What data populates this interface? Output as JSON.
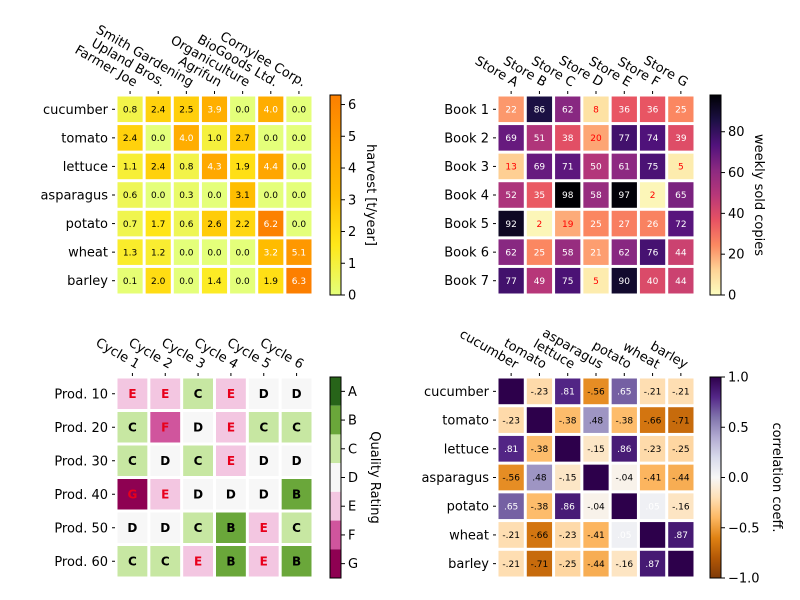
{
  "chart_data": [
    {
      "type": "heatmap",
      "id": "harvest",
      "columns": [
        "Farmer Joe",
        "Upland Bros.",
        "Smith Gardening",
        "Agrifun",
        "Organiculture",
        "BioGoods Ltd.",
        "Cornylee Corp."
      ],
      "rows": [
        "cucumber",
        "tomato",
        "lettuce",
        "asparagus",
        "potato",
        "wheat",
        "barley"
      ],
      "values": [
        [
          0.8,
          2.4,
          2.5,
          3.9,
          0.0,
          4.0,
          0.0
        ],
        [
          2.4,
          0.0,
          4.0,
          1.0,
          2.7,
          0.0,
          0.0
        ],
        [
          1.1,
          2.4,
          0.8,
          4.3,
          1.9,
          4.4,
          0.0
        ],
        [
          0.6,
          0.0,
          0.3,
          0.0,
          3.1,
          0.0,
          0.0
        ],
        [
          0.7,
          1.7,
          0.6,
          2.6,
          2.2,
          6.2,
          0.0
        ],
        [
          1.3,
          1.2,
          0.0,
          0.0,
          0.0,
          3.2,
          5.1
        ],
        [
          0.1,
          2.0,
          0.0,
          1.4,
          0.0,
          1.9,
          6.3
        ]
      ],
      "value_format": "0.0",
      "colormap": "Wistia",
      "vmin": 0,
      "vmax": 6.3,
      "colorbar": {
        "label": "harvest [t/year]",
        "ticks": [
          0,
          1,
          2,
          3,
          4,
          5,
          6
        ],
        "tick_labels": [
          "0",
          "1",
          "2",
          "3",
          "4",
          "5",
          "6"
        ]
      },
      "text_colors": {
        "dark": "#000000",
        "light": "#ffffff"
      },
      "light_threshold": 3.15
    },
    {
      "type": "heatmap",
      "id": "books",
      "columns": [
        "Store A",
        "Store B",
        "Store C",
        "Store D",
        "Store E",
        "Store F",
        "Store G"
      ],
      "rows": [
        "Book 1",
        "Book 2",
        "Book 3",
        "Book 4",
        "Book 5",
        "Book 6",
        "Book 7"
      ],
      "values": [
        [
          22,
          86,
          62,
          8,
          36,
          36,
          25
        ],
        [
          69,
          51,
          38,
          20,
          77,
          74,
          39
        ],
        [
          13,
          69,
          71,
          50,
          61,
          75,
          5
        ],
        [
          52,
          35,
          98,
          58,
          97,
          2,
          65
        ],
        [
          92,
          2,
          19,
          25,
          27,
          26,
          72
        ],
        [
          62,
          25,
          58,
          21,
          62,
          76,
          44
        ],
        [
          77,
          49,
          75,
          5,
          90,
          40,
          44
        ]
      ],
      "value_format": "0",
      "colormap": "magma_r",
      "vmin": 0,
      "vmax": 98,
      "colorbar": {
        "label": "weekly sold copies",
        "ticks": [
          0,
          20,
          40,
          60,
          80
        ],
        "tick_labels": [
          "0",
          "20",
          "40",
          "60",
          "80"
        ]
      },
      "text_colors": {
        "dark": "#ff0000",
        "light": "#ffffff"
      },
      "light_threshold": 20.5
    },
    {
      "type": "heatmap",
      "id": "quality",
      "columns": [
        "Cycle 1",
        "Cycle 2",
        "Cycle 3",
        "Cycle 4",
        "Cycle 5",
        "Cycle 6"
      ],
      "rows": [
        "Prod. 10",
        "Prod. 20",
        "Prod. 30",
        "Prod. 40",
        "Prod. 50",
        "Prod. 60"
      ],
      "values": [
        [
          "E",
          "E",
          "C",
          "E",
          "D",
          "D"
        ],
        [
          "C",
          "F",
          "D",
          "E",
          "C",
          "C"
        ],
        [
          "C",
          "D",
          "C",
          "E",
          "D",
          "D"
        ],
        [
          "G",
          "E",
          "D",
          "D",
          "D",
          "B"
        ],
        [
          "D",
          "D",
          "C",
          "B",
          "E",
          "C"
        ],
        [
          "C",
          "C",
          "E",
          "B",
          "E",
          "B"
        ]
      ],
      "colormap": "PiYG (7 levels)",
      "categories": [
        "A",
        "B",
        "C",
        "D",
        "E",
        "F",
        "G"
      ],
      "category_colors": [
        "#276419",
        "#6aa73a",
        "#c7e7a2",
        "#f7f7f7",
        "#f3c6e1",
        "#d0559d",
        "#8e0152"
      ],
      "colorbar": {
        "label": "Quality Rating",
        "tick_labels": [
          "A",
          "B",
          "C",
          "D",
          "E",
          "F",
          "G"
        ]
      },
      "text_colors": {
        "good": "#000000",
        "bad": "#e8001c"
      }
    },
    {
      "type": "heatmap",
      "id": "correlation",
      "columns": [
        "cucumber",
        "tomato",
        "lettuce",
        "asparagus",
        "potato",
        "wheat",
        "barley"
      ],
      "rows": [
        "cucumber",
        "tomato",
        "lettuce",
        "asparagus",
        "potato",
        "wheat",
        "barley"
      ],
      "values": [
        [
          1.0,
          -0.23,
          0.81,
          -0.56,
          0.65,
          -0.21,
          -0.21
        ],
        [
          -0.23,
          1.0,
          -0.38,
          0.48,
          -0.38,
          -0.66,
          -0.71
        ],
        [
          0.81,
          -0.38,
          1.0,
          -0.15,
          0.86,
          -0.23,
          -0.25
        ],
        [
          -0.56,
          0.48,
          -0.15,
          1.0,
          -0.04,
          -0.41,
          -0.44
        ],
        [
          0.65,
          -0.38,
          0.86,
          -0.04,
          1.0,
          0.05,
          -0.16
        ],
        [
          -0.21,
          -0.66,
          -0.23,
          -0.41,
          0.05,
          1.0,
          0.87
        ],
        [
          -0.21,
          -0.71,
          -0.25,
          -0.44,
          -0.16,
          0.87,
          1.0
        ]
      ],
      "cell_labels": [
        [
          "",
          "-.23",
          ".81",
          "-.56",
          ".65",
          "-.21",
          "-.21"
        ],
        [
          "-.23",
          "",
          "-.38",
          ".48",
          "-.38",
          "-.66",
          "-.71"
        ],
        [
          ".81",
          "-.38",
          "",
          "-.15",
          ".86",
          "-.23",
          "-.25"
        ],
        [
          "-.56",
          ".48",
          "-.15",
          "",
          "-.04",
          "-.41",
          "-.44"
        ],
        [
          ".65",
          "-.38",
          ".86",
          "-.04",
          "",
          ".05",
          "-.16"
        ],
        [
          "-.21",
          "-.66",
          "-.23",
          "-.41",
          ".05",
          "",
          ".87"
        ],
        [
          "-.21",
          "-.71",
          "-.25",
          "-.44",
          "-.16",
          ".87",
          ""
        ]
      ],
      "colormap": "PuOr",
      "vmin": -1.0,
      "vmax": 1.0,
      "colorbar": {
        "label": "correlation coeff.",
        "ticks": [
          1.0,
          0.5,
          0.0,
          -0.5,
          -1.0
        ],
        "tick_labels": [
          "1.0",
          "0.5",
          "0.0",
          "−0.5",
          "−1.0"
        ]
      },
      "text_colors": {
        "dark": "#000000",
        "light": "#ffffff"
      }
    }
  ]
}
